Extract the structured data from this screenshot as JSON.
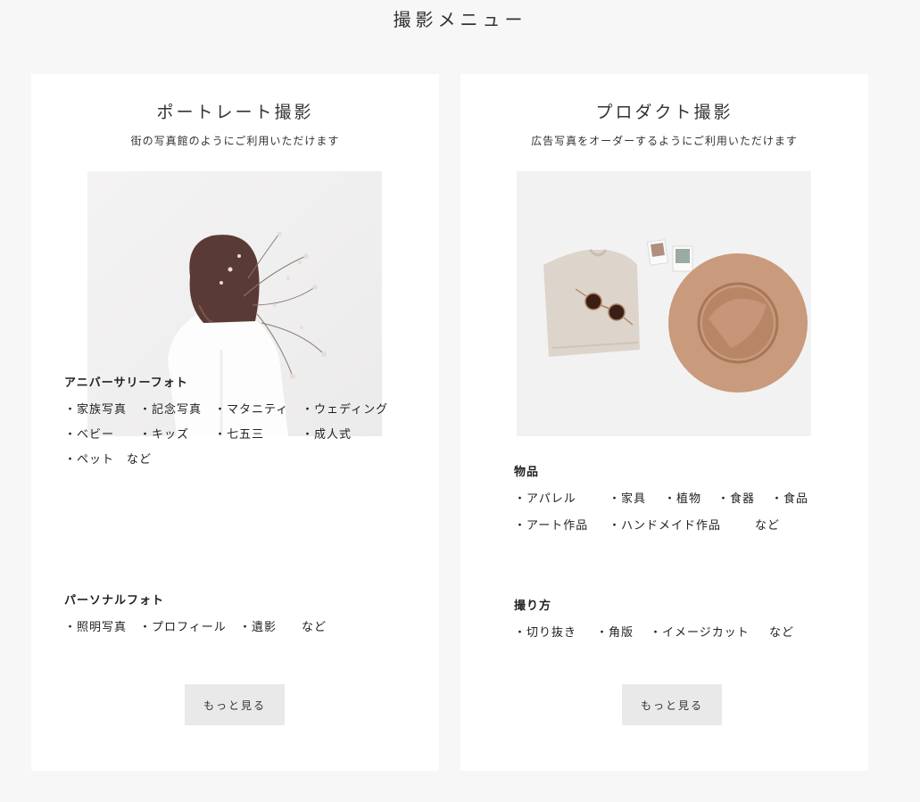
{
  "page": {
    "title": "撮影メニュー"
  },
  "cards": [
    {
      "title": "ポートレート撮影",
      "subtitle": "街の写真館のようにご利用いただけます",
      "photo_desc": "portrait",
      "sections": [
        {
          "heading": "アニバーサリーフォト",
          "rows": [
            [
              "・家族写真",
              "・記念写真",
              "・マタニティ",
              "・ウェディング"
            ],
            [
              "・ベビー",
              "・キッズ",
              "・七五三",
              "・成人式"
            ],
            [
              "・ペット",
              "など"
            ]
          ]
        },
        {
          "heading": "パーソナルフォト",
          "rows": [
            [
              "・照明写真",
              "・プロフィール",
              "・遺影",
              "など"
            ]
          ]
        }
      ],
      "button": "もっと見る"
    },
    {
      "title": "プロダクト撮影",
      "subtitle": "広告写真をオーダーするようにご利用いただけます",
      "photo_desc": "product",
      "sections": [
        {
          "heading": "物品",
          "rows": [
            [
              "・アパレル",
              "・家具",
              "・植物",
              "・食器",
              "・食品"
            ],
            [
              "・アート作品",
              "・ハンドメイド作品",
              "など"
            ]
          ]
        },
        {
          "heading": "撮り方",
          "rows": [
            [
              "・切り抜き",
              "・角版",
              "・イメージカット",
              "など"
            ]
          ]
        }
      ],
      "button": "もっと見る"
    }
  ],
  "colors": {
    "card_bg": "#ffffff",
    "page_bg": "#f7f7f7",
    "button_bg": "#e9e9e9",
    "hat": "#c99a7c",
    "sweater": "#ddd4cb"
  }
}
